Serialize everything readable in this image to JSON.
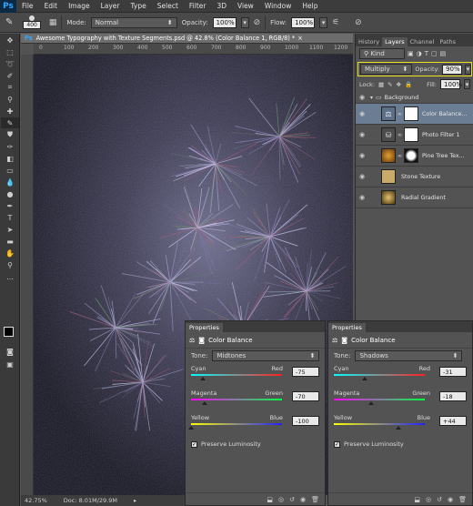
{
  "app": {
    "logo": "Ps",
    "menu": [
      "File",
      "Edit",
      "Image",
      "Layer",
      "Type",
      "Select",
      "Filter",
      "3D",
      "View",
      "Window",
      "Help"
    ]
  },
  "options": {
    "brush_size": "400",
    "mode_label": "Mode:",
    "mode_value": "Normal",
    "opacity_label": "Opacity:",
    "opacity_value": "100%",
    "flow_label": "Flow:",
    "flow_value": "100%"
  },
  "document": {
    "tab_title": "Awesome Typography with Texture Segments.psd @ 42.8% (Color Balance 1, RGB/8) *",
    "zoom": "42.75%",
    "doc_size": "Doc: 8.01M/29.9M",
    "ruler_marks": [
      "0",
      "100",
      "200",
      "300",
      "400",
      "500",
      "600",
      "700",
      "800",
      "900",
      "1000",
      "1100",
      "1200"
    ]
  },
  "layers_panel": {
    "tabs": [
      "History",
      "Layers",
      "Channel",
      "Paths"
    ],
    "active_tab": "Layers",
    "kind_label": "Kind",
    "blend_mode": "Multiply",
    "opacity_label": "Opacity:",
    "opacity_value": "90%",
    "lock_label": "Lock:",
    "fill_label": "Fill:",
    "fill_value": "100%",
    "group_name": "Background",
    "layers": [
      {
        "name": "Color Balance...",
        "selected": true
      },
      {
        "name": "Photo Filter 1",
        "selected": false
      },
      {
        "name": "Pine Tree Tex...",
        "selected": false
      },
      {
        "name": "Stone Texture",
        "selected": false
      },
      {
        "name": "Radial Gradient",
        "selected": false
      }
    ]
  },
  "properties_1": {
    "tab": "Properties",
    "title": "Color Balance",
    "tone_label": "Tone:",
    "tone_value": "Midtones",
    "cyan": "Cyan",
    "red": "Red",
    "cyan_red": "-75",
    "magenta": "Magenta",
    "green": "Green",
    "magenta_green": "-70",
    "yellow": "Yellow",
    "blue": "Blue",
    "yellow_blue": "-100",
    "preserve": "Preserve Luminosity"
  },
  "properties_2": {
    "tab": "Properties",
    "title": "Color Balance",
    "tone_label": "Tone:",
    "tone_value": "Shadows",
    "cyan": "Cyan",
    "red": "Red",
    "cyan_red": "-31",
    "magenta": "Magenta",
    "green": "Green",
    "magenta_green": "-18",
    "yellow": "Yellow",
    "blue": "Blue",
    "yellow_blue": "+44",
    "preserve": "Preserve Luminosity"
  },
  "colors": {
    "accent": "#31a8ff",
    "selected_row": "#6b7d93",
    "highlight_border": "#e8e020"
  }
}
